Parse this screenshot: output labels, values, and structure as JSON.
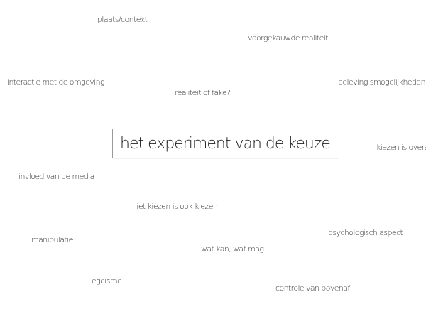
{
  "central_topic": "het experiment van de keuze",
  "words": [
    "plaats/context",
    "voorgekauwde realiteit",
    "interactie met de omgeving",
    "realiteit of fake?",
    "beleving smogelijkheden",
    "kiezen is overal",
    "invloed van de media",
    "niet kiezen is ook kiezen",
    "psychologisch aspect",
    "manipulatie",
    "wat kan, wat mag",
    "egoïsme",
    "controle van bovenaf"
  ]
}
